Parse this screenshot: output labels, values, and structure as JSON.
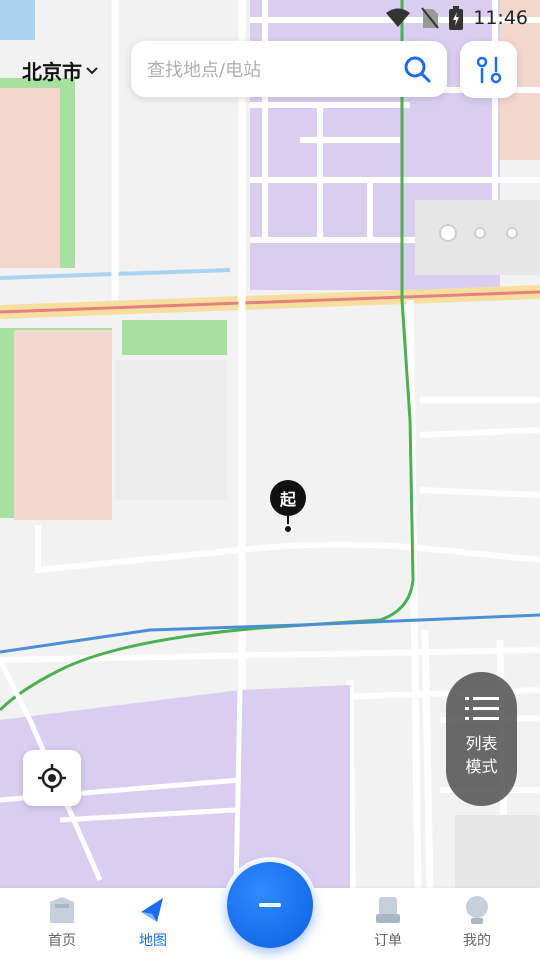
{
  "status_bar": {
    "time": "11:46",
    "icons": [
      "wifi-icon",
      "no-sim-icon",
      "battery-charging-icon"
    ]
  },
  "header": {
    "city": "北京市",
    "city_icon": "chevron-down-icon",
    "search_placeholder": "查找地点/电站",
    "search_icon": "search-icon",
    "filter_icon": "filter-icon"
  },
  "map": {
    "start_marker_label": "起",
    "list_mode_label_line1": "列表",
    "list_mode_label_line2": "模式",
    "locate_icon": "locate-icon",
    "colors": {
      "background": "#f2f2f2",
      "residential": "#d9cef0",
      "green": "#a8e0a0",
      "commercial": "#f3d6cc",
      "road": "#ffffff",
      "highway_yellow": "#f6dfa0",
      "highway_red": "#e88080",
      "metro_green": "#4caf50",
      "metro_blue": "#4a8fd6",
      "water": "#aad3f0"
    }
  },
  "bottom_nav": {
    "items": [
      {
        "label": "首页",
        "icon": "home-icon",
        "active": false
      },
      {
        "label": "地图",
        "icon": "map-icon",
        "active": true
      },
      {
        "label": "订单",
        "icon": "order-icon",
        "active": false
      },
      {
        "label": "我的",
        "icon": "profile-icon",
        "active": false
      }
    ],
    "center_button_icon": "scan-icon",
    "accent": "#1a6cf0"
  }
}
